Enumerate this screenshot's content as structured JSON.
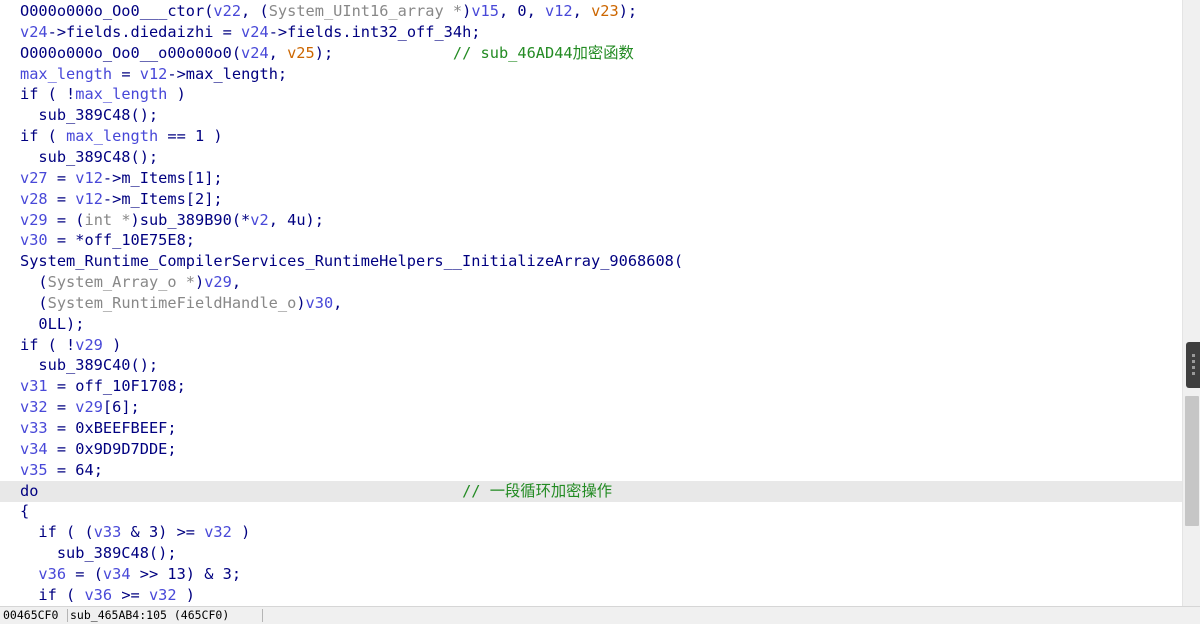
{
  "code_lines": [
    {
      "segments": [
        {
          "text": "O000o000o_Oo0___ctor(",
          "cls": "t-f"
        },
        {
          "text": "v22",
          "cls": "t-v"
        },
        {
          "text": ", (",
          "cls": "t-f"
        },
        {
          "text": "System_UInt16_array *",
          "cls": "t-g"
        },
        {
          "text": ")",
          "cls": "t-f"
        },
        {
          "text": "v15",
          "cls": "t-v"
        },
        {
          "text": ", 0, ",
          "cls": "t-f"
        },
        {
          "text": "v12",
          "cls": "t-v"
        },
        {
          "text": ", ",
          "cls": "t-f"
        },
        {
          "text": "v23",
          "cls": "t-o"
        },
        {
          "text": ");",
          "cls": "t-f"
        }
      ]
    },
    {
      "segments": [
        {
          "text": "v24",
          "cls": "t-v"
        },
        {
          "text": "->fields.diedaizhi = ",
          "cls": "t-f"
        },
        {
          "text": "v24",
          "cls": "t-v"
        },
        {
          "text": "->fields.int32_off_34h;",
          "cls": "t-f"
        }
      ]
    },
    {
      "segments": [
        {
          "text": "O000o000o_Oo0__o00o00o0(",
          "cls": "t-f"
        },
        {
          "text": "v24",
          "cls": "t-v"
        },
        {
          "text": ", ",
          "cls": "t-f"
        },
        {
          "text": "v25",
          "cls": "t-o"
        },
        {
          "text": ");             ",
          "cls": "t-f"
        },
        {
          "text": "// sub_46AD44加密函数",
          "cls": "t-c"
        }
      ]
    },
    {
      "segments": [
        {
          "text": "max_length",
          "cls": "t-v"
        },
        {
          "text": " = ",
          "cls": "t-f"
        },
        {
          "text": "v12",
          "cls": "t-v"
        },
        {
          "text": "->max_length;",
          "cls": "t-f"
        }
      ]
    },
    {
      "segments": [
        {
          "text": "if ( !",
          "cls": "t-f"
        },
        {
          "text": "max_length",
          "cls": "t-v"
        },
        {
          "text": " )",
          "cls": "t-f"
        }
      ]
    },
    {
      "segments": [
        {
          "text": "  sub_389C48();",
          "cls": "t-f"
        }
      ]
    },
    {
      "segments": [
        {
          "text": "if ( ",
          "cls": "t-f"
        },
        {
          "text": "max_length",
          "cls": "t-v"
        },
        {
          "text": " == 1 )",
          "cls": "t-f"
        }
      ]
    },
    {
      "segments": [
        {
          "text": "  sub_389C48();",
          "cls": "t-f"
        }
      ]
    },
    {
      "segments": [
        {
          "text": "v27",
          "cls": "t-v"
        },
        {
          "text": " = ",
          "cls": "t-f"
        },
        {
          "text": "v12",
          "cls": "t-v"
        },
        {
          "text": "->m_Items[1];",
          "cls": "t-f"
        }
      ]
    },
    {
      "segments": [
        {
          "text": "v28",
          "cls": "t-v"
        },
        {
          "text": " = ",
          "cls": "t-f"
        },
        {
          "text": "v12",
          "cls": "t-v"
        },
        {
          "text": "->m_Items[2];",
          "cls": "t-f"
        }
      ]
    },
    {
      "segments": [
        {
          "text": "v29",
          "cls": "t-v"
        },
        {
          "text": " = (",
          "cls": "t-f"
        },
        {
          "text": "int *",
          "cls": "t-g"
        },
        {
          "text": ")sub_389B90(*",
          "cls": "t-f"
        },
        {
          "text": "v2",
          "cls": "t-v"
        },
        {
          "text": ", 4u);",
          "cls": "t-f"
        }
      ]
    },
    {
      "segments": [
        {
          "text": "v30",
          "cls": "t-v"
        },
        {
          "text": " = *off_10E75E8;",
          "cls": "t-f"
        }
      ]
    },
    {
      "segments": [
        {
          "text": "System_Runtime_CompilerServices_RuntimeHelpers__InitializeArray_9068608(",
          "cls": "t-f"
        }
      ]
    },
    {
      "segments": [
        {
          "text": "  (",
          "cls": "t-f"
        },
        {
          "text": "System_Array_o *",
          "cls": "t-g"
        },
        {
          "text": ")",
          "cls": "t-f"
        },
        {
          "text": "v29",
          "cls": "t-v"
        },
        {
          "text": ",",
          "cls": "t-f"
        }
      ]
    },
    {
      "segments": [
        {
          "text": "  (",
          "cls": "t-f"
        },
        {
          "text": "System_RuntimeFieldHandle_o",
          "cls": "t-g"
        },
        {
          "text": ")",
          "cls": "t-f"
        },
        {
          "text": "v30",
          "cls": "t-v"
        },
        {
          "text": ",",
          "cls": "t-f"
        }
      ]
    },
    {
      "segments": [
        {
          "text": "  0LL);",
          "cls": "t-f"
        }
      ]
    },
    {
      "segments": [
        {
          "text": "if ( !",
          "cls": "t-f"
        },
        {
          "text": "v29",
          "cls": "t-v"
        },
        {
          "text": " )",
          "cls": "t-f"
        }
      ]
    },
    {
      "segments": [
        {
          "text": "  sub_389C40();",
          "cls": "t-f"
        }
      ]
    },
    {
      "segments": [
        {
          "text": "v31",
          "cls": "t-v"
        },
        {
          "text": " = off_10F1708;",
          "cls": "t-f"
        }
      ]
    },
    {
      "segments": [
        {
          "text": "v32",
          "cls": "t-v"
        },
        {
          "text": " = ",
          "cls": "t-f"
        },
        {
          "text": "v29",
          "cls": "t-v"
        },
        {
          "text": "[6];",
          "cls": "t-f"
        }
      ]
    },
    {
      "segments": [
        {
          "text": "v33",
          "cls": "t-v"
        },
        {
          "text": " = 0xBEEFBEEF;",
          "cls": "t-f"
        }
      ]
    },
    {
      "segments": [
        {
          "text": "v34",
          "cls": "t-v"
        },
        {
          "text": " = 0x9D9D7DDE;",
          "cls": "t-f"
        }
      ]
    },
    {
      "segments": [
        {
          "text": "v35",
          "cls": "t-v"
        },
        {
          "text": " = 64;",
          "cls": "t-f"
        }
      ]
    },
    {
      "highlighted": true,
      "segments": [
        {
          "text": "do",
          "cls": "t-f"
        },
        {
          "text": "                                              ",
          "cls": "t-f"
        },
        {
          "text": "// 一段循环加密操作",
          "cls": "t-c"
        }
      ]
    },
    {
      "segments": [
        {
          "text": "{",
          "cls": "t-f"
        }
      ]
    },
    {
      "segments": [
        {
          "text": "  if ( (",
          "cls": "t-f"
        },
        {
          "text": "v33",
          "cls": "t-v"
        },
        {
          "text": " & 3) >= ",
          "cls": "t-f"
        },
        {
          "text": "v32",
          "cls": "t-v"
        },
        {
          "text": " )",
          "cls": "t-f"
        }
      ]
    },
    {
      "segments": [
        {
          "text": "    sub_389C48();",
          "cls": "t-f"
        }
      ]
    },
    {
      "segments": [
        {
          "text": "  ",
          "cls": "t-f"
        },
        {
          "text": "v36",
          "cls": "t-v"
        },
        {
          "text": " = (",
          "cls": "t-f"
        },
        {
          "text": "v34",
          "cls": "t-v"
        },
        {
          "text": " >> 13) & 3;",
          "cls": "t-f"
        }
      ]
    },
    {
      "segments": [
        {
          "text": "  if ( ",
          "cls": "t-f"
        },
        {
          "text": "v36",
          "cls": "t-v"
        },
        {
          "text": " >= ",
          "cls": "t-f"
        },
        {
          "text": "v32",
          "cls": "t-v"
        },
        {
          "text": " )",
          "cls": "t-f"
        }
      ]
    }
  ],
  "status_bar": {
    "offset": "00465CF0",
    "location": "sub_465AB4:105 (465CF0)"
  },
  "colors": {
    "text": "#000080",
    "variable": "#4848d8",
    "argument": "#cc6600",
    "type_cast": "#888888",
    "comment": "#238b23",
    "highlight_line": "#e8e8e8"
  }
}
